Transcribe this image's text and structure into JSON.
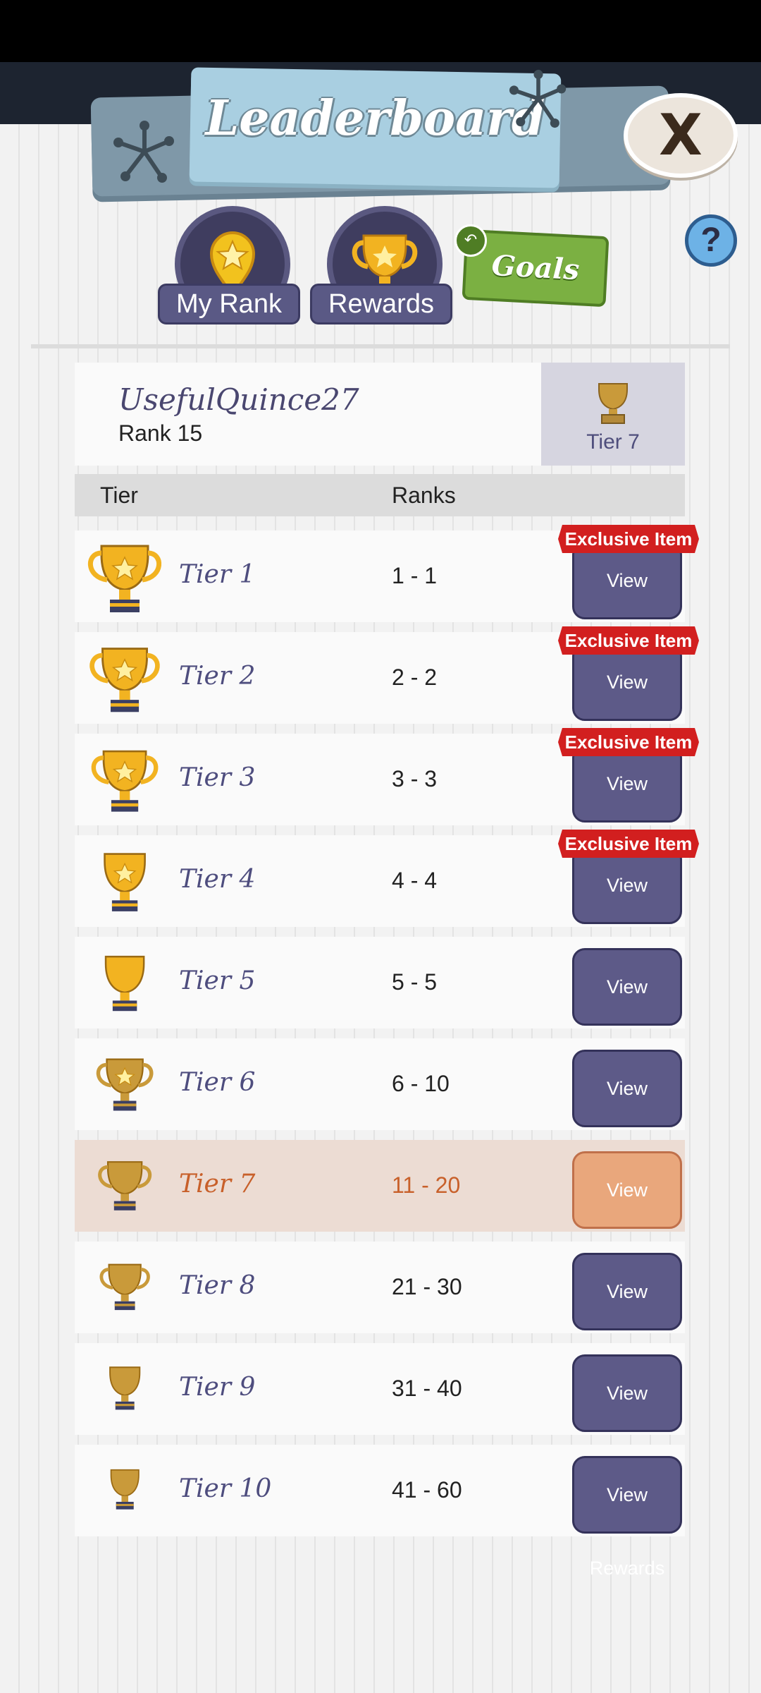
{
  "header": {
    "title": "Leaderboard",
    "close_label": "X"
  },
  "nav": {
    "my_rank_label": "My Rank",
    "rewards_label": "Rewards",
    "goals_label": "Goals",
    "help_label": "?"
  },
  "user": {
    "name": "UsefulQuince27",
    "rank": "Rank 15",
    "tier": "Tier 7"
  },
  "table": {
    "col_tier": "Tier",
    "col_ranks": "Ranks",
    "rows": [
      {
        "tier": "Tier 1",
        "ranks": "1 - 1",
        "button": "View Rewards",
        "badge": "Exclusive Item"
      },
      {
        "tier": "Tier 2",
        "ranks": "2 - 2",
        "button": "View Rewards",
        "badge": "Exclusive Item"
      },
      {
        "tier": "Tier 3",
        "ranks": "3 - 3",
        "button": "View Rewards",
        "badge": "Exclusive Item"
      },
      {
        "tier": "Tier 4",
        "ranks": "4 - 4",
        "button": "View Rewards",
        "badge": "Exclusive Item"
      },
      {
        "tier": "Tier 5",
        "ranks": "5 - 5",
        "button": "View Rewards"
      },
      {
        "tier": "Tier 6",
        "ranks": "6 - 10",
        "button": "View Rewards"
      },
      {
        "tier": "Tier 7",
        "ranks": "11 - 20",
        "button": "View Rewards",
        "current": true
      },
      {
        "tier": "Tier 8",
        "ranks": "21 - 30",
        "button": "View Rewards"
      },
      {
        "tier": "Tier 9",
        "ranks": "31 - 40",
        "button": "View Rewards"
      },
      {
        "tier": "Tier 10",
        "ranks": "41 - 60",
        "button": "View Rewards"
      }
    ]
  },
  "colors": {
    "accent_purple": "#5d5a88",
    "current_orange": "#c8602a",
    "badge_red": "#d21f1f",
    "goals_green": "#7bb042"
  },
  "icons": {
    "close": "close-icon",
    "my_rank": "location-star-icon",
    "rewards": "trophy-icon",
    "goals": "back-arrow-icon",
    "help": "help-icon"
  }
}
